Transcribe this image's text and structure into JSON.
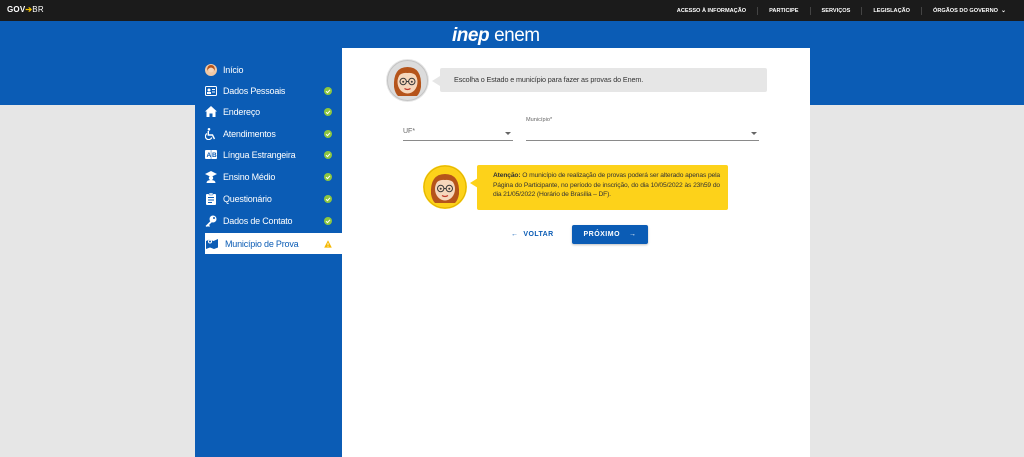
{
  "govbar": {
    "logo_gov": "GOV",
    "logo_br": "BR",
    "links": [
      "ACESSO À INFORMAÇÃO",
      "PARTICIPE",
      "SERVIÇOS",
      "LEGISLAÇÃO",
      "ÓRGÃOS DO GOVERNO"
    ]
  },
  "header": {
    "brand_inep": "inep",
    "brand_enem": "enem"
  },
  "sidebar": {
    "items": [
      {
        "label": "Início",
        "icon": "user-avatar-icon",
        "status": "none"
      },
      {
        "label": "Dados Pessoais",
        "icon": "id-card-icon",
        "status": "done"
      },
      {
        "label": "Endereço",
        "icon": "home-icon",
        "status": "done"
      },
      {
        "label": "Atendimentos",
        "icon": "wheelchair-icon",
        "status": "done"
      },
      {
        "label": "Língua Estrangeira",
        "icon": "translate-icon",
        "status": "done"
      },
      {
        "label": "Ensino Médio",
        "icon": "graduation-icon",
        "status": "done"
      },
      {
        "label": "Questionário",
        "icon": "clipboard-icon",
        "status": "done"
      },
      {
        "label": "Dados de Contato",
        "icon": "key-icon",
        "status": "done"
      },
      {
        "label": "Município de Prova",
        "icon": "map-icon",
        "status": "warning",
        "active": true
      }
    ]
  },
  "main": {
    "bubble_text": "Escolha o Estado e município para fazer as provas do Enem.",
    "uf_select": {
      "placeholder": "UF*"
    },
    "municipio_select": {
      "label": "Município*"
    },
    "notice": {
      "title": "Atenção:",
      "text": "O município de realização de provas poderá ser alterado apenas pela Página do Participante, no período de inscrição, do dia 10/05/2022 às 23h59 do dia 21/05/2022 (Horário de Brasília – DF)."
    },
    "back_button": {
      "label": "VOLTAR"
    },
    "next_button": {
      "label": "PRÓXIMO"
    }
  },
  "colors": {
    "primary_blue": "#0b5cb5",
    "topbar": "#1b1b1b",
    "warning_yellow": "#fdd21a",
    "success_green": "#8dc63f",
    "page_gray": "#e6e6e6"
  }
}
